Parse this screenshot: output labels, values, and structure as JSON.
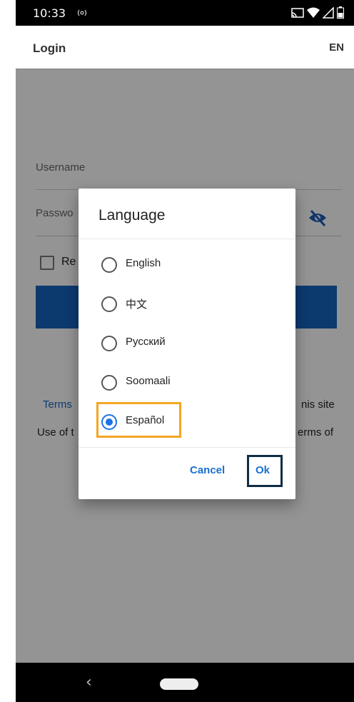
{
  "status_bar": {
    "time": "10:33",
    "icons": [
      "nfc-icon",
      "cast-icon",
      "wifi-icon",
      "signal-icon",
      "battery-icon"
    ]
  },
  "app_bar": {
    "title": "Login",
    "language_code": "EN"
  },
  "login_form": {
    "username_label": "Username",
    "password_label": "Passwo",
    "remember_label": "Re",
    "terms_link": "Terms",
    "site_text": "nis site",
    "use_of_text": "Use of t",
    "terms_of_text": "erms of"
  },
  "dialog": {
    "title": "Language",
    "options": [
      {
        "label": "English",
        "selected": false
      },
      {
        "label": "中文",
        "selected": false
      },
      {
        "label": "Русский",
        "selected": false
      },
      {
        "label": "Soomaali",
        "selected": false
      },
      {
        "label": "Español",
        "selected": true
      }
    ],
    "cancel_label": "Cancel",
    "ok_label": "Ok"
  },
  "colors": {
    "accent": "#1a73e8",
    "login_button": "#1565c0",
    "highlight_selected": "#f5a623",
    "highlight_ok": "#0f2d44"
  },
  "nav_bar": {
    "icons": [
      "back-icon",
      "home-pill-icon"
    ]
  }
}
